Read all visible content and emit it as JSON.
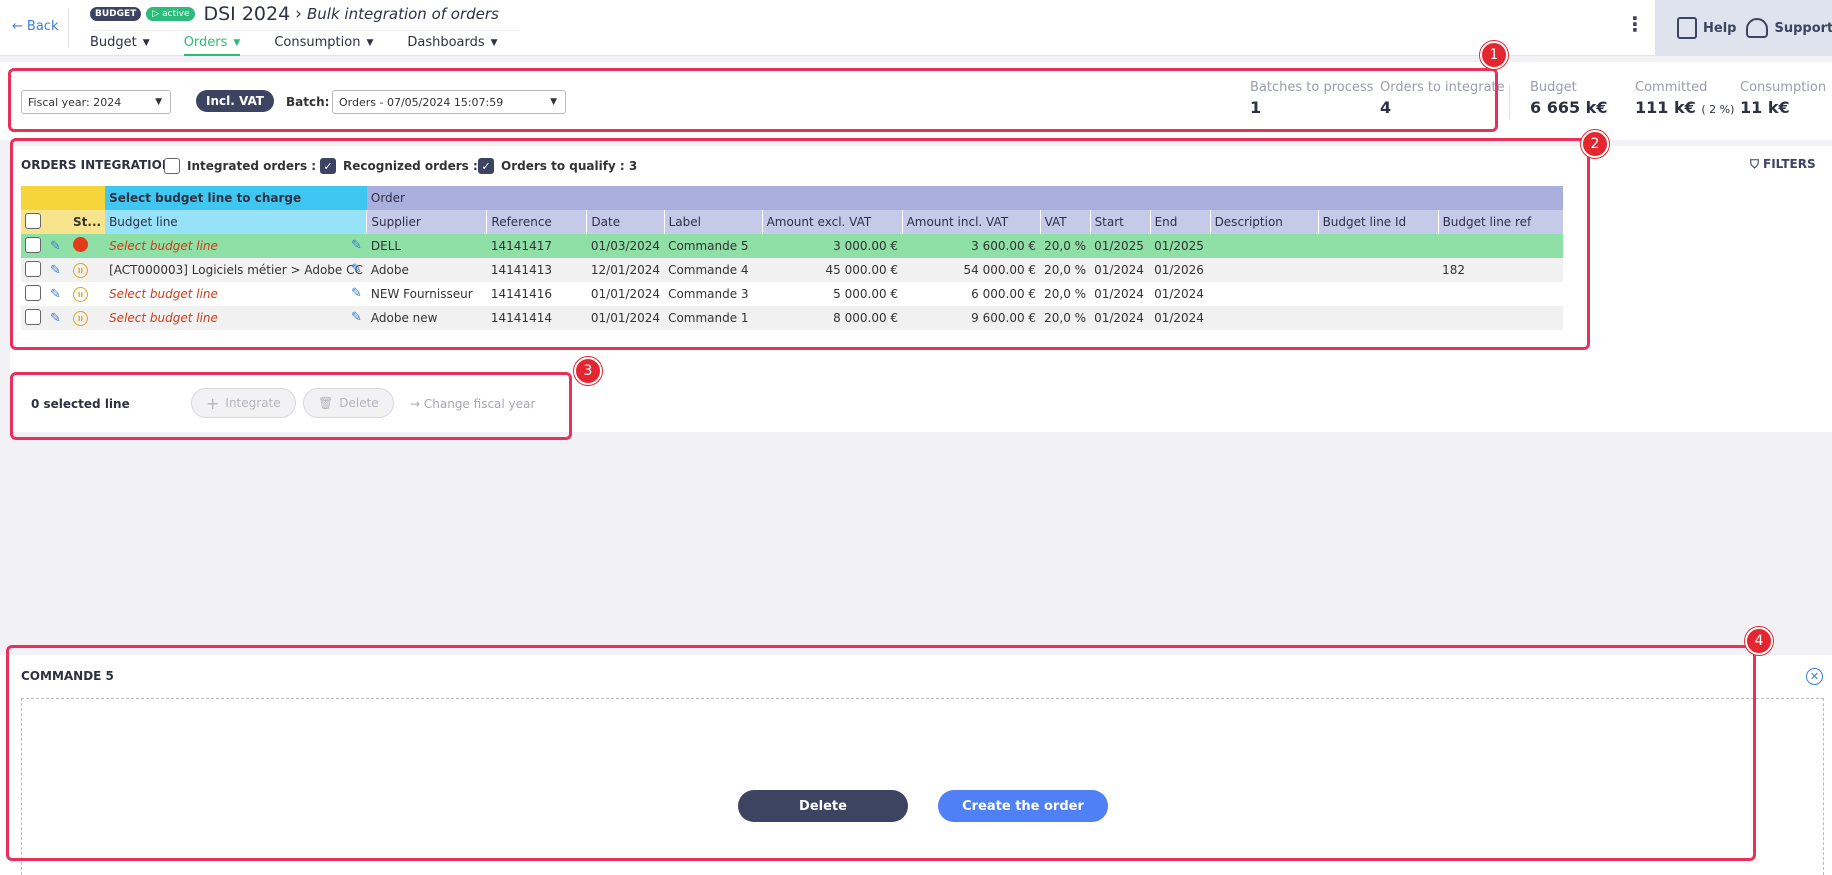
{
  "header": {
    "back_label": "Back",
    "badge_budget": "BUDGET",
    "badge_active": "active",
    "app_title": "DSI 2024",
    "page_title": "Bulk integration of orders",
    "nav": [
      {
        "label": "Budget"
      },
      {
        "label": "Orders"
      },
      {
        "label": "Consumption"
      },
      {
        "label": "Dashboards"
      }
    ],
    "help_label": "Help",
    "support_label": "Support"
  },
  "filters": {
    "fiscal_year": "Fiscal year: 2024",
    "vat_mode": "Incl. VAT",
    "batch_label": "Batch:",
    "batch_value": "Orders - 07/05/2024 15:07:59"
  },
  "kpis": {
    "batches_label": "Batches to process",
    "batches_value": "1",
    "orders_label": "Orders to integrate",
    "orders_value": "4",
    "budget_label": "Budget",
    "budget_value": "6 665 k€",
    "committed_label": "Committed",
    "committed_value": "111 k€",
    "committed_pct": "( 2 %)",
    "consumption_label": "Consumption",
    "consumption_value": "11 k€"
  },
  "orders": {
    "title": "ORDERS INTEGRATION",
    "integrated_label": "Integrated orders : 0",
    "recognized_label": "Recognized orders : 1",
    "qualify_label": "Orders to qualify : 3",
    "filters_label": "FILTERS",
    "group_select": "Select budget line to charge",
    "group_order": "Order",
    "col_status": "St...",
    "col_budget_line": "Budget line",
    "columns": [
      "Supplier",
      "Reference",
      "Date",
      "Label",
      "Amount excl. VAT",
      "Amount incl. VAT",
      "VAT",
      "Start",
      "End",
      "Description",
      "Budget line Id",
      "Budget line ref"
    ],
    "rows": [
      {
        "budget_line": "Select budget line",
        "supplier": "DELL",
        "reference": "14141417",
        "date": "01/03/2024",
        "label": "Commande 5",
        "excl": "3 000.00 €",
        "incl": "3 600.00 €",
        "vat": "20,0 %",
        "start": "01/2025",
        "end": "01/2025",
        "description": "",
        "bl_id": "",
        "bl_ref": ""
      },
      {
        "budget_line": "[ACT000003] Logiciels métier > Adobe CC",
        "supplier": "Adobe",
        "reference": "14141413",
        "date": "12/01/2024",
        "label": "Commande 4",
        "excl": "45 000.00 €",
        "incl": "54 000.00 €",
        "vat": "20,0 %",
        "start": "01/2024",
        "end": "01/2026",
        "description": "",
        "bl_id": "",
        "bl_ref": "182"
      },
      {
        "budget_line": "Select budget line",
        "supplier": "NEW Fournisseur",
        "reference": "14141416",
        "date": "01/01/2024",
        "label": "Commande 3",
        "excl": "5 000.00 €",
        "incl": "6 000.00 €",
        "vat": "20,0 %",
        "start": "01/2024",
        "end": "01/2024",
        "description": "",
        "bl_id": "",
        "bl_ref": ""
      },
      {
        "budget_line": "Select budget line",
        "supplier": "Adobe new",
        "reference": "14141414",
        "date": "01/01/2024",
        "label": "Commande 1",
        "excl": "8 000.00 €",
        "incl": "9 600.00 €",
        "vat": "20,0 %",
        "start": "01/2024",
        "end": "01/2024",
        "description": "",
        "bl_id": "",
        "bl_ref": ""
      }
    ]
  },
  "actions": {
    "selected_count": "0 selected line",
    "integrate_label": "Integrate",
    "delete_label": "Delete",
    "change_fy_label": "Change fiscal year"
  },
  "detail": {
    "title": "COMMANDE 5",
    "delete_label": "Delete",
    "create_label": "Create the order"
  },
  "annotations": [
    "1",
    "2",
    "3",
    "4"
  ],
  "colors": {
    "accent_green": "#2dbb7a",
    "navy": "#3d4462",
    "callout_red": "#e8305a",
    "primary_blue": "#4f80f6"
  }
}
